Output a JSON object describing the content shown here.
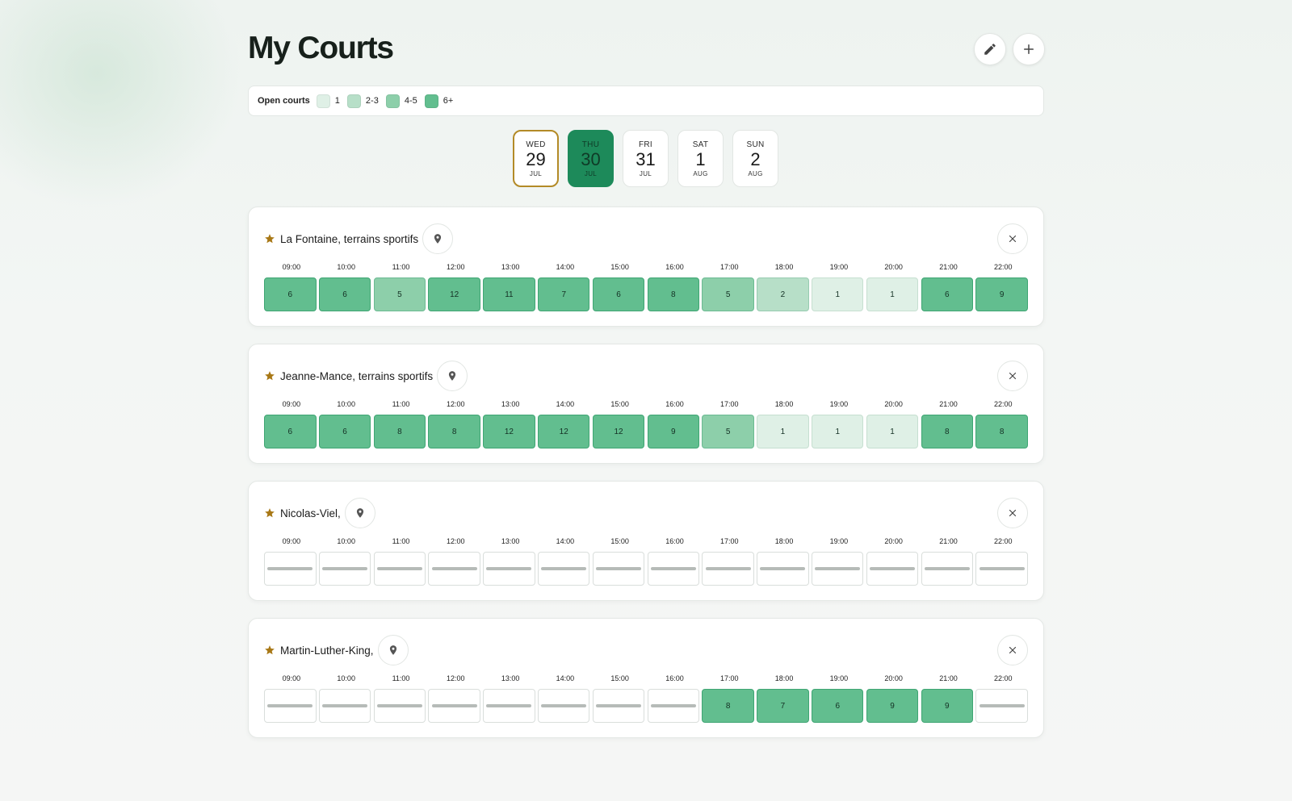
{
  "header": {
    "title": "My Courts"
  },
  "legend": {
    "title": "Open courts",
    "items": [
      {
        "label": "1",
        "color": "#dff0e6"
      },
      {
        "label": "2-3",
        "color": "#b7dfc8"
      },
      {
        "label": "4-5",
        "color": "#8dcfaa"
      },
      {
        "label": "6+",
        "color": "#62be8f"
      }
    ]
  },
  "days": [
    {
      "dow": "WED",
      "num": "29",
      "mon": "JUL",
      "state": "today"
    },
    {
      "dow": "THU",
      "num": "30",
      "mon": "JUL",
      "state": "selected"
    },
    {
      "dow": "FRI",
      "num": "31",
      "mon": "JUL",
      "state": ""
    },
    {
      "dow": "SAT",
      "num": "1",
      "mon": "AUG",
      "state": ""
    },
    {
      "dow": "SUN",
      "num": "2",
      "mon": "AUG",
      "state": ""
    }
  ],
  "hours": [
    "09:00",
    "10:00",
    "11:00",
    "12:00",
    "13:00",
    "14:00",
    "15:00",
    "16:00",
    "17:00",
    "18:00",
    "19:00",
    "20:00",
    "21:00",
    "22:00"
  ],
  "courts": [
    {
      "name": "La Fontaine, terrains sportifs",
      "slots": [
        6,
        6,
        5,
        12,
        11,
        7,
        6,
        8,
        5,
        2,
        1,
        1,
        6,
        9
      ]
    },
    {
      "name": "Jeanne-Mance, terrains sportifs",
      "slots": [
        6,
        6,
        8,
        8,
        12,
        12,
        12,
        9,
        5,
        1,
        1,
        1,
        8,
        8
      ]
    },
    {
      "name": "Nicolas-Viel,",
      "slots": [
        null,
        null,
        null,
        null,
        null,
        null,
        null,
        null,
        null,
        null,
        null,
        null,
        null,
        null
      ]
    },
    {
      "name": "Martin-Luther-King,",
      "slots": [
        null,
        null,
        null,
        null,
        null,
        null,
        null,
        null,
        8,
        7,
        6,
        9,
        9,
        null
      ]
    }
  ],
  "icons": {
    "edit": "pencil-icon",
    "add": "plus-icon",
    "favorite": "star-icon",
    "location": "map-pin-icon",
    "remove": "close-icon"
  },
  "colors": {
    "accent": "#1d8a5a",
    "today_border": "#b38a27",
    "star": "#a87816"
  }
}
